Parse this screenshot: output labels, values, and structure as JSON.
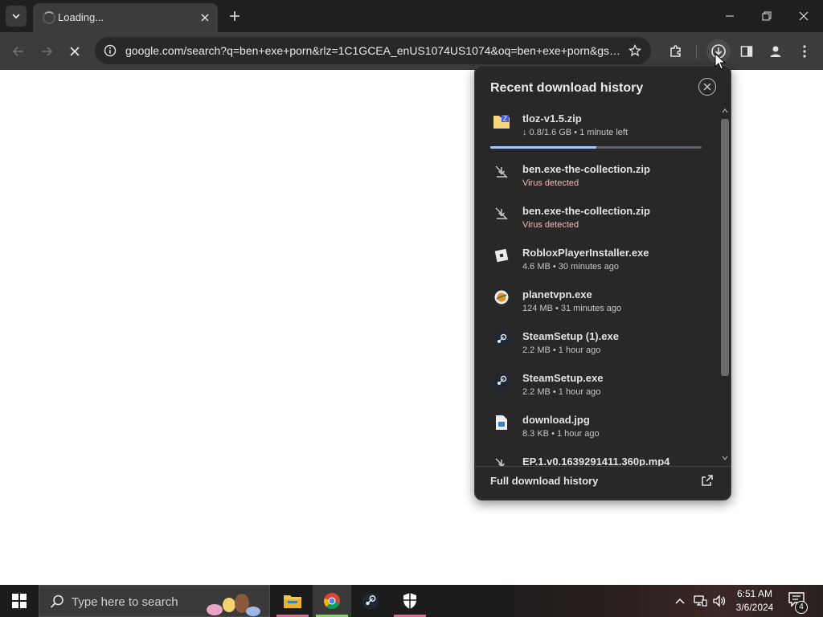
{
  "browser": {
    "tab": {
      "title": "Loading..."
    },
    "omnibox": {
      "url": "google.com/search?q=ben+exe+porn&rlz=1C1GCEA_enUS1074US1074&oq=ben+exe+porn&gs_..."
    }
  },
  "downloads": {
    "title": "Recent download history",
    "items": [
      {
        "name": "tloz-v1.5.zip",
        "status": "↓ 0.8/1.6 GB • 1 minute left",
        "progress": 0.5,
        "icon": "zip-folder-icon",
        "state": "in-progress"
      },
      {
        "name": "ben.exe-the-collection.zip",
        "status": "Virus detected",
        "icon": "download-blocked-icon",
        "state": "virus"
      },
      {
        "name": "ben.exe-the-collection.zip",
        "status": "Virus detected",
        "icon": "download-blocked-icon",
        "state": "virus"
      },
      {
        "name": "RobloxPlayerInstaller.exe",
        "status": "4.6 MB • 30 minutes ago",
        "icon": "roblox-icon",
        "state": "done"
      },
      {
        "name": "planetvpn.exe",
        "status": "124 MB • 31 minutes ago",
        "icon": "planetvpn-icon",
        "state": "done"
      },
      {
        "name": "SteamSetup (1).exe",
        "status": "2.2 MB • 1 hour ago",
        "icon": "steam-icon",
        "state": "done"
      },
      {
        "name": "SteamSetup.exe",
        "status": "2.2 MB • 1 hour ago",
        "icon": "steam-icon",
        "state": "done"
      },
      {
        "name": "download.jpg",
        "status": "8.3 KB • 1 hour ago",
        "icon": "image-file-icon",
        "state": "done"
      },
      {
        "name": "EP.1.v0.1639291411.360p.mp4",
        "status": "",
        "icon": "download-blocked-icon",
        "state": "partial"
      }
    ],
    "footer_label": "Full download history"
  },
  "taskbar": {
    "search_placeholder": "Type here to search",
    "time": "6:51 AM",
    "date": "3/6/2024",
    "notification_count": "4"
  },
  "colors": {
    "accent": "#a8c7fa",
    "virus_text": "#f2b8b5",
    "panel_bg": "#282828"
  }
}
